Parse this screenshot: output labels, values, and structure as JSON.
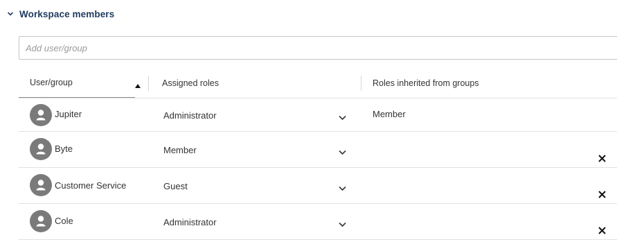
{
  "section": {
    "title": "Workspace members"
  },
  "add_input": {
    "placeholder": "Add user/group",
    "value": ""
  },
  "table": {
    "columns": {
      "user": "User/group",
      "assigned": "Assigned roles",
      "inherited": "Roles inherited from groups"
    },
    "sort": {
      "column": "user",
      "direction": "ascending"
    },
    "rows": [
      {
        "name": "Jupiter",
        "role": "Administrator",
        "inherited": "Member",
        "removable": false
      },
      {
        "name": "Byte",
        "role": "Member",
        "inherited": "",
        "removable": true
      },
      {
        "name": "Customer Service",
        "role": "Guest",
        "inherited": "",
        "removable": true
      },
      {
        "name": "Cole",
        "role": "Administrator",
        "inherited": "",
        "removable": true
      }
    ]
  },
  "icons": {
    "section_toggle": "chevron-down-icon",
    "avatar": "user-avatar-icon",
    "role_dropdown": "chevron-down-icon",
    "remove": "close-icon",
    "sort": "sort-ascending-icon"
  },
  "colors": {
    "section_title": "#1e3a5f",
    "avatar_bg": "#7a7a7a",
    "border": "#c4c4c4",
    "row_divider": "#e2e2e2"
  }
}
